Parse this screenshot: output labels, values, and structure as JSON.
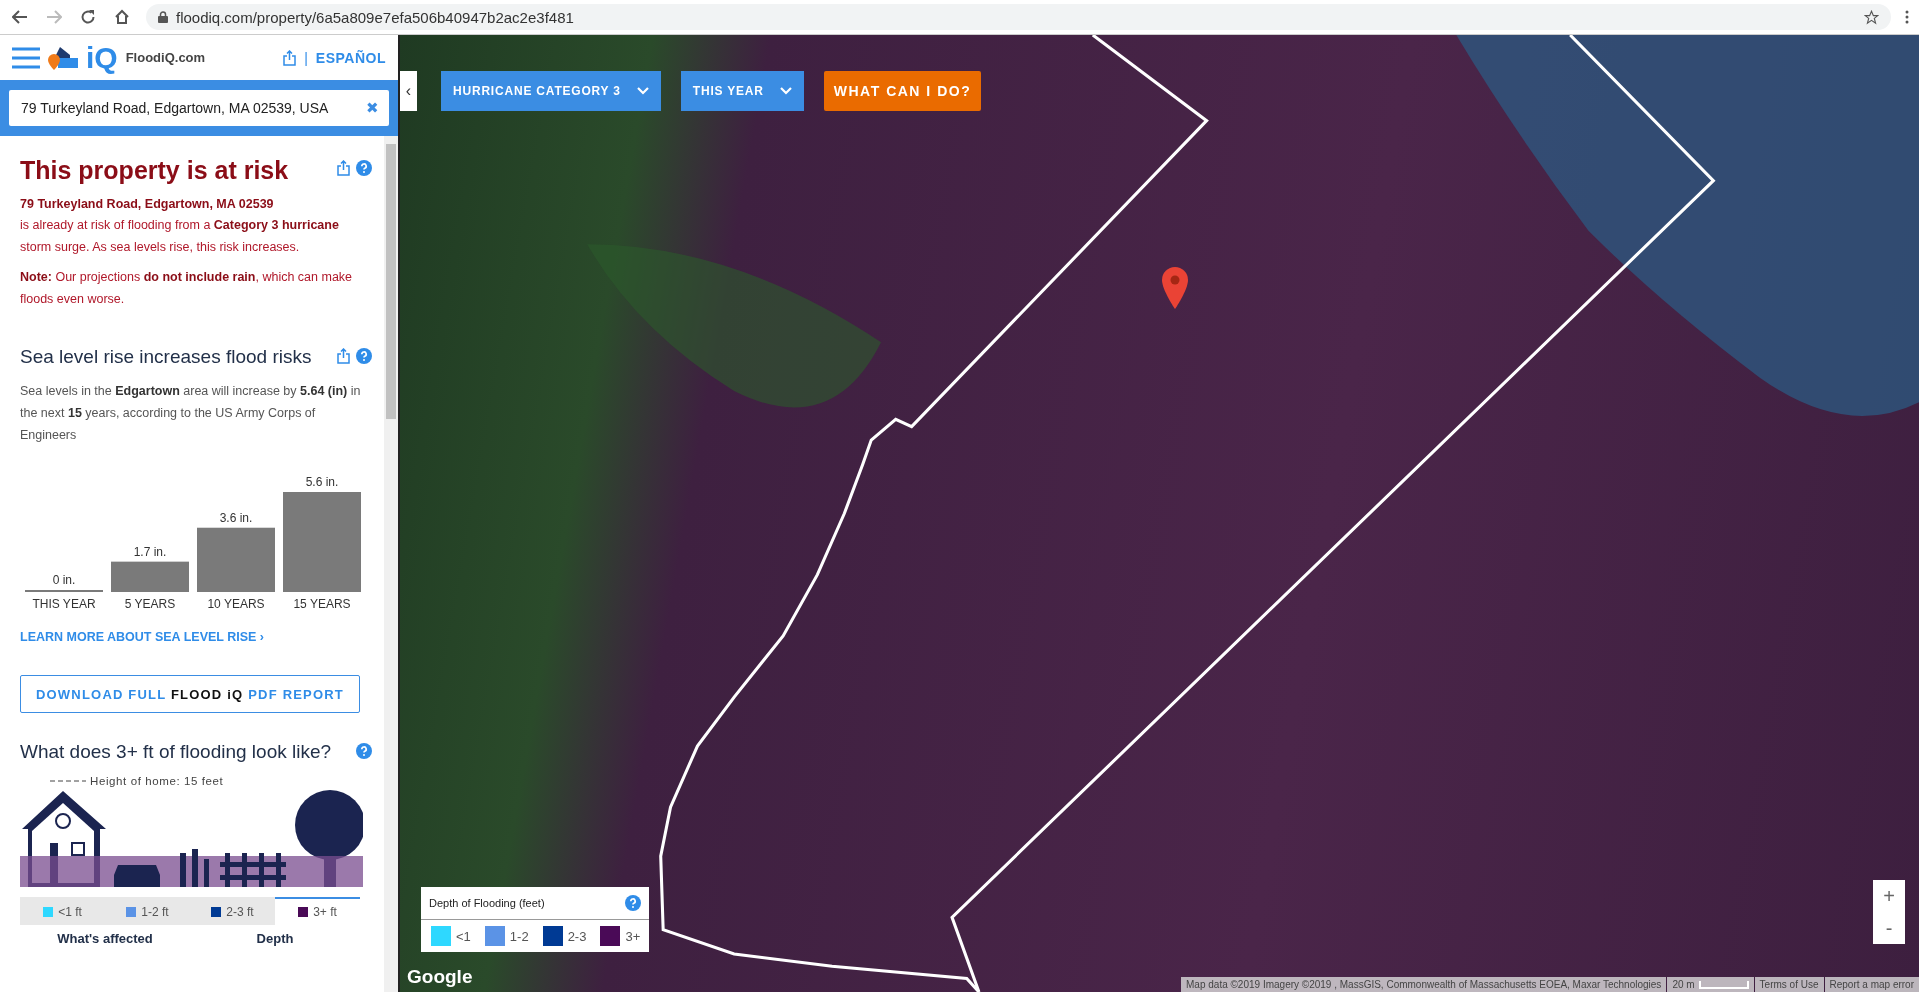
{
  "browser": {
    "url": "floodiq.com/property/6a5a809e7efa506b40947b2ac2e3f481",
    "forward_disabled": true
  },
  "header": {
    "brand": "FloodiQ.com",
    "logo_text": "iQ",
    "language_link": "ESPAÑOL",
    "divider": "|"
  },
  "search": {
    "value": "79 Turkeyland Road, Edgartown, MA 02539, USA",
    "clear": "✖"
  },
  "risk": {
    "title": "This property is at risk",
    "address": "79 Turkeyland Road, Edgartown, MA 02539",
    "summary": "is already at risk of flooding from a **Category 3 hurricane** storm surge. As sea levels rise, this risk increases.",
    "note": "**Note:** Our projections **do not include rain**, which can make floods even worse."
  },
  "sea_level": {
    "title": "Sea level rise increases flood risks",
    "text": "Sea levels in the **Edgartown** area will increase by **5.64 (in)** in the next **15** years, according to the US Army Corps of Engineers",
    "chart_data": {
      "type": "bar",
      "categories": [
        "THIS YEAR",
        "5 YEARS",
        "10 YEARS",
        "15 YEARS"
      ],
      "values": [
        0,
        1.7,
        3.6,
        5.6
      ],
      "data_labels": true,
      "value_labels": [
        "0 in.",
        "1.7 in.",
        "3.6 in.",
        "5.6 in."
      ]
    },
    "link": "LEARN MORE ABOUT SEA LEVEL RISE ›"
  },
  "download_button": "DOWNLOAD FULL **FLOOD iQ** PDF REPORT",
  "flooding": {
    "title": "What does 3+ ft of flooding look like?",
    "height_label": "Height of home: 15 feet",
    "depth_tabs": [
      {
        "label": "<1 ft",
        "color": "#2ed8ff",
        "selected": false
      },
      {
        "label": "1-2 ft",
        "color": "#5b93e6",
        "selected": false
      },
      {
        "label": "2-3 ft",
        "color": "#003a94",
        "selected": false
      },
      {
        "label": "3+ ft",
        "color": "#4a0a57",
        "selected": true
      }
    ],
    "table_columns": [
      "What's affected",
      "Depth"
    ]
  },
  "map_controls": {
    "collapse": "‹",
    "scenario": "HURRICANE CATEGORY 3",
    "timeframe": "THIS YEAR",
    "action": "WHAT CAN I DO?"
  },
  "legend": {
    "title": "Depth of Flooding (feet)",
    "items": [
      {
        "label": "<1",
        "color": "#2ed8ff"
      },
      {
        "label": "1-2",
        "color": "#5b93e6"
      },
      {
        "label": "2-3",
        "color": "#003a94"
      },
      {
        "label": "3+",
        "color": "#4a0a57"
      }
    ]
  },
  "map": {
    "logo": "Google",
    "zoom_in": "+",
    "zoom_out": "-",
    "attribution": "Map data ©2019 Imagery ©2019 , MassGIS, Commonwealth of Massachusetts EOEA, Maxar Technologies",
    "scale": "20 m",
    "terms": "Terms of Use",
    "report": "Report a map error"
  }
}
